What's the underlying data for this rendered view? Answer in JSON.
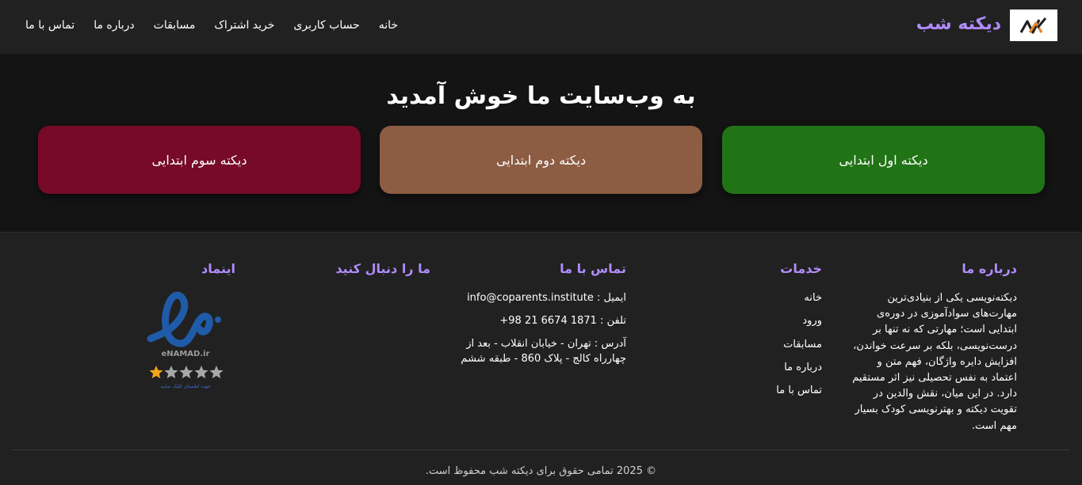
{
  "header": {
    "brand": "دیکته شب",
    "nav": [
      "خانه",
      "حساب کاربری",
      "خرید اشتراک",
      "مسابقات",
      "درباره ما",
      "تماس با ما"
    ]
  },
  "hero": {
    "title": "به وب‌سایت ما خوش آمدید",
    "cards": [
      {
        "label": "دیکته اول ابتدایی",
        "color": "#217416"
      },
      {
        "label": "دیکته دوم ابتدایی",
        "color": "#8c5c43"
      },
      {
        "label": "دیکته سوم ابتدایی",
        "color": "#760a28"
      }
    ]
  },
  "footer": {
    "about": {
      "title": "درباره ما",
      "text": "دیکته‌نویسی یکی از بنیادی‌ترین مهارت‌های سوادآموزی در دوره‌ی ابتدایی است؛ مهارتی که نه تنها بر درست‌نویسی، بلکه بر سرعت خواندن، افزایش دایره واژگان، فهم متن و اعتماد به نفس تحصیلی نیز اثر مستقیم دارد. در این میان، نقش والدین در تقویت دیکته و بهترنویسی کودک بسیار مهم است."
    },
    "services": {
      "title": "خدمات",
      "items": [
        "خانه",
        "ورود",
        "مسابقات",
        "درباره ما",
        "تماس با ما"
      ]
    },
    "contact": {
      "title": "تماس با ما",
      "email": "ایمیل : info@coparents.institute",
      "phone": "تلفن : 1871 6674 21 98+",
      "address": "آدرس : تهران - خیابان انقلاب - بعد از چهارراه کالج - پلاک 860 - طبقه ششم"
    },
    "social": {
      "title": "ما را دنبال کنید"
    },
    "enamad": {
      "title": "اینماد",
      "logo_text": "eNAMAD.ir",
      "caption": "جهت اطمینان کلیک نمایید",
      "stars": 1,
      "stars_max": 5
    },
    "copyright": "© 2025 تمامی حقوق برای دیکته شب محفوظ است."
  },
  "colors": {
    "accent": "#b18cff",
    "header_bg": "#212121",
    "page_bg": "#141414"
  }
}
